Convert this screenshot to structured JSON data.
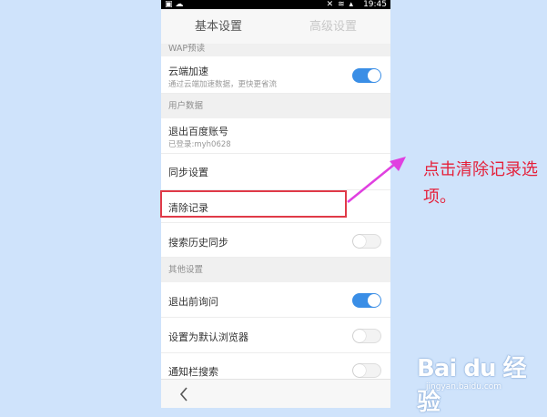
{
  "status_bar": {
    "time": "19:45",
    "icons": "▣ ☁",
    "right_icons": "✕ ≋ ▴"
  },
  "tabs": [
    {
      "label": "基本设置"
    },
    {
      "label": "高级设置"
    }
  ],
  "sections": {
    "wap": {
      "header": "WAP预读"
    },
    "cloud": {
      "title": "云端加速",
      "subtitle": "通过云端加速数据，更快更省流",
      "toggle": "on"
    },
    "user_data": {
      "header": "用户数据"
    },
    "logout": {
      "title": "退出百度账号",
      "subtitle": "已登录:myh0628"
    },
    "sync": {
      "title": "同步设置"
    },
    "clear": {
      "title": "清除记录"
    },
    "search_history": {
      "title": "搜索历史同步",
      "toggle": "off"
    },
    "other": {
      "header": "其他设置"
    },
    "exit_ask": {
      "title": "退出前询问",
      "toggle": "on"
    },
    "default_browser": {
      "title": "设置为默认浏览器",
      "toggle": "off"
    },
    "notify_search": {
      "title": "通知栏搜索",
      "toggle": "off"
    }
  },
  "annotation": {
    "text": "点击清除记录选项。"
  },
  "watermark": {
    "logo": "Bai du 经验",
    "url": "jingyan.baidu.com"
  },
  "colors": {
    "accent": "#3a8ee6",
    "highlight": "#e03a48",
    "annotation": "#e5203a",
    "arrow": "#e040e0"
  }
}
